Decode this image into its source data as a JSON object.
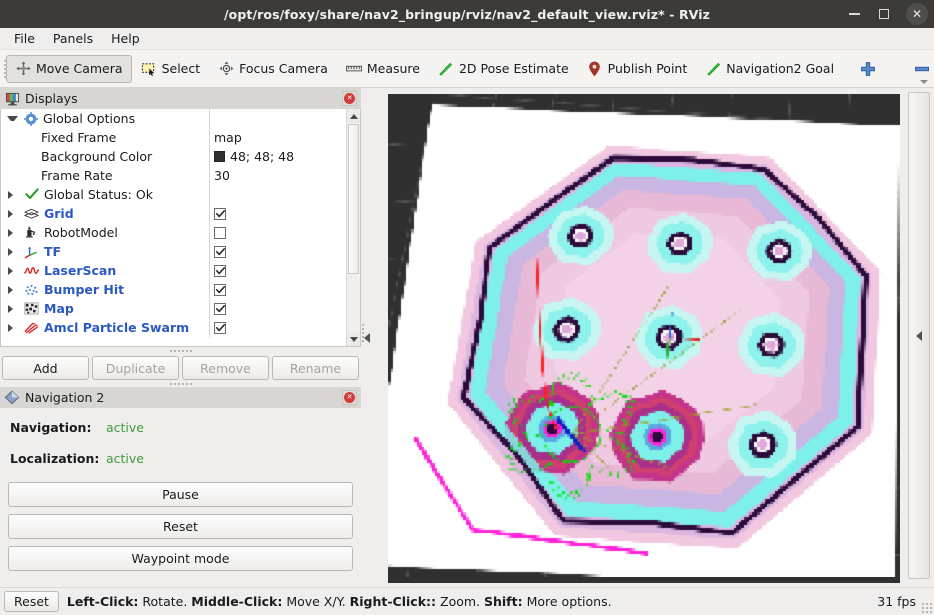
{
  "window": {
    "title": "/opt/ros/foxy/share/nav2_bringup/rviz/nav2_default_view.rviz* - RViz",
    "minimize_label": "minimize",
    "maximize_label": "maximize",
    "close_label": "✕"
  },
  "menubar": [
    {
      "label": "File"
    },
    {
      "label": "Panels"
    },
    {
      "label": "Help"
    }
  ],
  "toolbar": {
    "buttons": [
      {
        "label": "Move Camera",
        "icon": "move-camera-icon",
        "active": true
      },
      {
        "label": "Select",
        "icon": "select-icon",
        "active": false
      },
      {
        "label": "Focus Camera",
        "icon": "focus-camera-icon",
        "active": false
      },
      {
        "label": "Measure",
        "icon": "measure-icon",
        "active": false
      },
      {
        "label": "2D Pose Estimate",
        "icon": "pose-estimate-icon",
        "active": false
      },
      {
        "label": "Publish Point",
        "icon": "publish-point-icon",
        "active": false
      },
      {
        "label": "Navigation2 Goal",
        "icon": "navigation-goal-icon",
        "active": false
      }
    ],
    "plus_icon": "plus-icon",
    "minus_icon": "minus-icon"
  },
  "displays_panel": {
    "title": "Displays",
    "close_label": "×",
    "rows": [
      {
        "arrow": "down",
        "icon": "gear-icon",
        "label": "Global Options",
        "style": "plain",
        "indent": 0,
        "value_type": "none"
      },
      {
        "arrow": "none",
        "icon": "none",
        "label": "Fixed Frame",
        "style": "plain",
        "indent": 1,
        "value_type": "text",
        "value": "map"
      },
      {
        "arrow": "none",
        "icon": "none",
        "label": "Background Color",
        "style": "plain",
        "indent": 1,
        "value_type": "color",
        "value": "48; 48; 48",
        "color": "#303030"
      },
      {
        "arrow": "none",
        "icon": "none",
        "label": "Frame Rate",
        "style": "plain",
        "indent": 1,
        "value_type": "text",
        "value": "30"
      },
      {
        "arrow": "right",
        "icon": "check-icon",
        "label": "Global Status: Ok",
        "style": "plain",
        "indent": 0,
        "value_type": "none"
      },
      {
        "arrow": "right",
        "icon": "grid-icon",
        "label": "Grid",
        "style": "blue",
        "indent": 0,
        "value_type": "checkbox",
        "checked": true
      },
      {
        "arrow": "right",
        "icon": "robot-model-icon",
        "label": "RobotModel",
        "style": "plain",
        "indent": 0,
        "value_type": "checkbox",
        "checked": false
      },
      {
        "arrow": "right",
        "icon": "tf-axes-icon",
        "label": "TF",
        "style": "blue",
        "indent": 0,
        "value_type": "checkbox",
        "checked": true
      },
      {
        "arrow": "right",
        "icon": "laser-scan-icon",
        "label": "LaserScan",
        "style": "blue",
        "indent": 0,
        "value_type": "checkbox",
        "checked": true
      },
      {
        "arrow": "right",
        "icon": "bumper-hit-icon",
        "label": "Bumper Hit",
        "style": "blue",
        "indent": 0,
        "value_type": "checkbox",
        "checked": true
      },
      {
        "arrow": "right",
        "icon": "map-icon",
        "label": "Map",
        "style": "blue",
        "indent": 0,
        "value_type": "checkbox",
        "checked": true
      },
      {
        "arrow": "right",
        "icon": "particle-swarm-icon",
        "label": "Amcl Particle Swarm",
        "style": "blue",
        "indent": 0,
        "value_type": "checkbox",
        "checked": true
      }
    ],
    "buttons": [
      {
        "label": "Add",
        "enabled": true
      },
      {
        "label": "Duplicate",
        "enabled": false
      },
      {
        "label": "Remove",
        "enabled": false
      },
      {
        "label": "Rename",
        "enabled": false
      }
    ]
  },
  "nav2_panel": {
    "title": "Navigation 2",
    "close_label": "×",
    "navigation_key": "Navigation:",
    "navigation_value": "active",
    "localization_key": "Localization:",
    "localization_value": "active",
    "buttons": [
      {
        "label": "Pause"
      },
      {
        "label": "Reset"
      },
      {
        "label": "Waypoint mode"
      }
    ]
  },
  "statusbar": {
    "reset_label": "Reset",
    "hint_parts": [
      {
        "text": "Left-Click:",
        "bold": true
      },
      {
        "text": " Rotate. ",
        "bold": false
      },
      {
        "text": "Middle-Click:",
        "bold": true
      },
      {
        "text": " Move X/Y. ",
        "bold": false
      },
      {
        "text": "Right-Click::",
        "bold": true
      },
      {
        "text": " Zoom. ",
        "bold": false
      },
      {
        "text": "Shift:",
        "bold": true
      },
      {
        "text": " More options.",
        "bold": false
      }
    ],
    "fps": "31 fps"
  },
  "render_view": {
    "background_color": "#303030",
    "grid_color": "#787878",
    "map_free_color": "#ffffff",
    "map_occupied_color": "#2b0b3a",
    "costmap_colors": [
      "#7cf2ea",
      "#c8b4de",
      "#e0a8c8",
      "#cf3f6f",
      "#9a2c78",
      "#ff22d8"
    ],
    "laser_color": "#00e000",
    "particle_color": "#c8c800",
    "path_color": "#ff2020",
    "robot_color": "#1020c0"
  },
  "colors": {
    "accent_blue": "#2b59c3",
    "status_green": "#3f9c3f",
    "titlebar_bg": "#3c3b37",
    "panel_bg": "#efeeec",
    "panel_header_bg": "#d8d6d2"
  }
}
